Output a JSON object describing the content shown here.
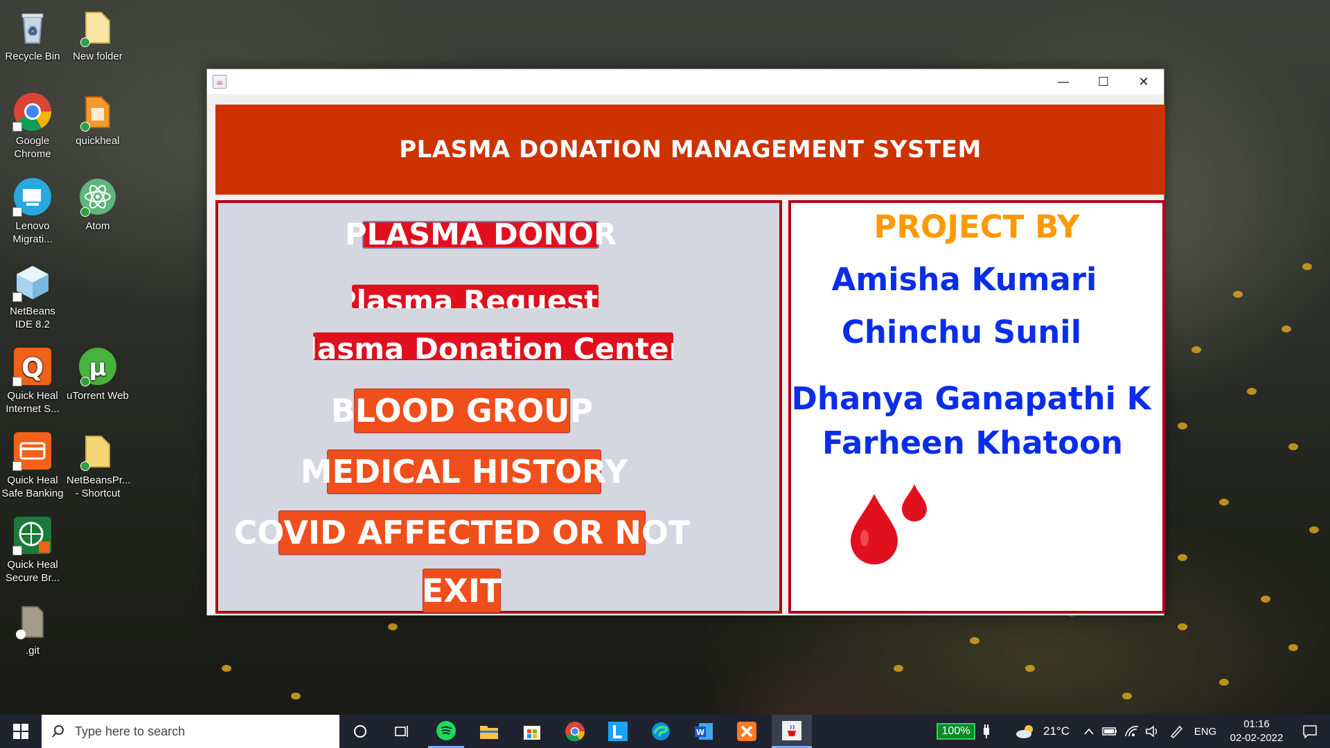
{
  "desktop": {
    "icons": [
      {
        "label": "Recycle Bin"
      },
      {
        "label": "New folder"
      },
      {
        "label": "Google Chrome"
      },
      {
        "label": "quickheal"
      },
      {
        "label": "Lenovo Migrati..."
      },
      {
        "label": "Atom"
      },
      {
        "label": "NetBeans IDE 8.2"
      },
      {
        "label": "Quick Heal Internet S..."
      },
      {
        "label": "uTorrent Web"
      },
      {
        "label": "Quick Heal Safe Banking"
      },
      {
        "label": "NetBeansPr... - Shortcut"
      },
      {
        "label": "Quick Heal Secure Br..."
      },
      {
        "label": ".git"
      }
    ]
  },
  "window": {
    "title": "",
    "controls": {
      "minimize": "—",
      "maximize": "☐",
      "close": "✕"
    },
    "banner_title": "PLASMA DONATION MANAGEMENT SYSTEM",
    "menu": {
      "plasma_donor": "PLASMA DONOR",
      "plasma_requests": "Plasma Requests",
      "donation_centers": "Plasma Donation Centers",
      "blood_group": "BLOOD GROUP",
      "medical_history": "MEDICAL HISTORY",
      "covid": "COVID AFFECTED OR NOT",
      "exit": "EXIT"
    },
    "credits": {
      "heading": "PROJECT BY",
      "names": [
        "Amisha Kumari",
        "Chinchu Sunil",
        "Dhanya Ganapathi K",
        "Farheen Khatoon"
      ]
    },
    "colors": {
      "banner": "#cc3300",
      "panel_border": "#b3001b",
      "heading": "#ff9900",
      "names": "#0a2ee8",
      "drop": "#e0101e"
    }
  },
  "taskbar": {
    "search_placeholder": "Type here to search",
    "battery": "100%",
    "temperature": "21°C",
    "language": "ENG",
    "time": "01:16",
    "date": "02-02-2022"
  }
}
